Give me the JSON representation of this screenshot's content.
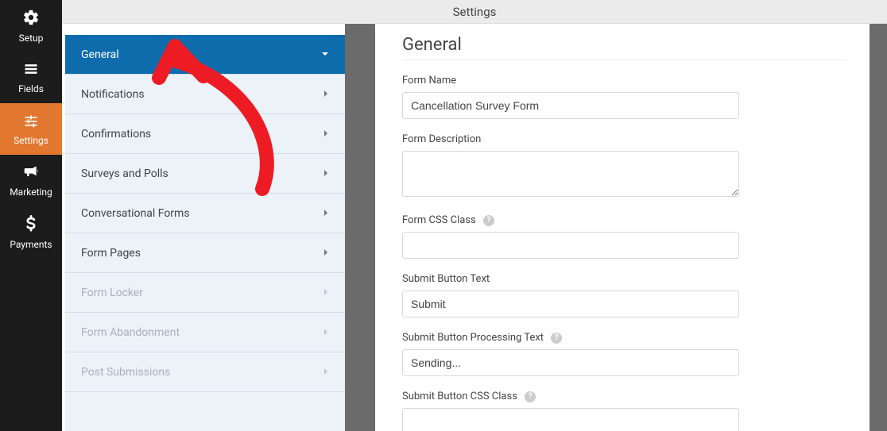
{
  "header": {
    "title": "Settings"
  },
  "nav": {
    "setup": "Setup",
    "fields": "Fields",
    "settings": "Settings",
    "marketing": "Marketing",
    "payments": "Payments"
  },
  "settings_panel": {
    "items": [
      {
        "label": "General",
        "active": true,
        "disabled": false
      },
      {
        "label": "Notifications",
        "active": false,
        "disabled": false
      },
      {
        "label": "Confirmations",
        "active": false,
        "disabled": false
      },
      {
        "label": "Surveys and Polls",
        "active": false,
        "disabled": false
      },
      {
        "label": "Conversational Forms",
        "active": false,
        "disabled": false
      },
      {
        "label": "Form Pages",
        "active": false,
        "disabled": false
      },
      {
        "label": "Form Locker",
        "active": false,
        "disabled": true
      },
      {
        "label": "Form Abandonment",
        "active": false,
        "disabled": true
      },
      {
        "label": "Post Submissions",
        "active": false,
        "disabled": true
      }
    ]
  },
  "main": {
    "heading": "General",
    "fields": {
      "form_name": {
        "label": "Form Name",
        "value": "Cancellation Survey Form"
      },
      "form_description": {
        "label": "Form Description",
        "value": ""
      },
      "form_css_class": {
        "label": "Form CSS Class",
        "value": ""
      },
      "submit_button_text": {
        "label": "Submit Button Text",
        "value": "Submit"
      },
      "submit_button_processing_text": {
        "label": "Submit Button Processing Text",
        "value": "Sending..."
      },
      "submit_button_css_class": {
        "label": "Submit Button CSS Class",
        "value": ""
      }
    }
  }
}
